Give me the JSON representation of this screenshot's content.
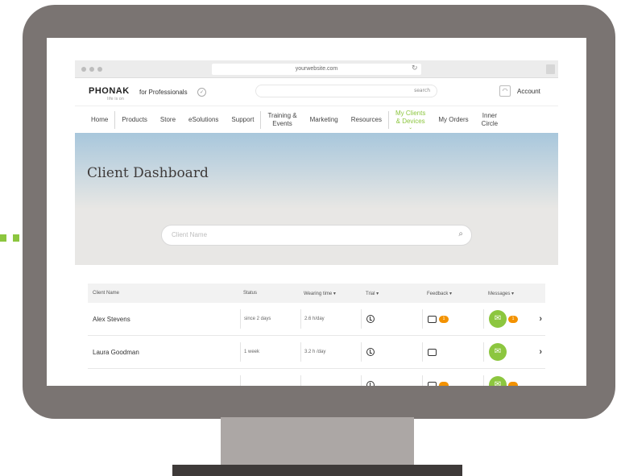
{
  "browser": {
    "url": "yourwebsite.com"
  },
  "header": {
    "logo": "PHONAK",
    "logo_tagline": "life is on",
    "pro_label": "for Professionals",
    "search_placeholder": "search",
    "account_label": "Account"
  },
  "nav": {
    "items": [
      {
        "label": "Home"
      },
      {
        "label": "Products"
      },
      {
        "label": "Store"
      },
      {
        "label": "eSolutions"
      },
      {
        "label": "Support"
      },
      {
        "label": "Training &\nEvents"
      },
      {
        "label": "Marketing"
      },
      {
        "label": "Resources"
      },
      {
        "label": "My Clients\n& Devices",
        "active": true
      },
      {
        "label": "My Orders"
      },
      {
        "label": "Inner\nCircle"
      }
    ]
  },
  "hero": {
    "title": "Client Dashboard"
  },
  "client_search": {
    "placeholder": "Client Name"
  },
  "table": {
    "headers": {
      "client_name": "Client Name",
      "status": "Status",
      "wearing_time": "Wearing time  ▾",
      "trial": "Trial ▾",
      "feedback": "Feedback  ▾",
      "messages": "Messages  ▾"
    },
    "rows": [
      {
        "name": "Alex Stevens",
        "status": "since 2 days",
        "wearing_time": "2.6 h/day",
        "feedback_badge": "1",
        "messages_badge": "1"
      },
      {
        "name": "Laura Goodman",
        "status": "1 week",
        "wearing_time": "3.2 h /day",
        "feedback_badge": "",
        "messages_badge": ""
      },
      {
        "name": "",
        "status": "",
        "wearing_time": "",
        "feedback_badge": "",
        "messages_badge": ""
      }
    ]
  },
  "colors": {
    "accent_green": "#8cc63f",
    "badge_orange": "#f39200",
    "monitor_frame": "#7a7472",
    "hero_blue": "#a8c7dc"
  },
  "icons": [
    "reload-icon",
    "check-circle-icon",
    "user-icon",
    "search-icon",
    "clock-icon",
    "feedback-icon",
    "chat-icon",
    "chevron-right-icon"
  ]
}
